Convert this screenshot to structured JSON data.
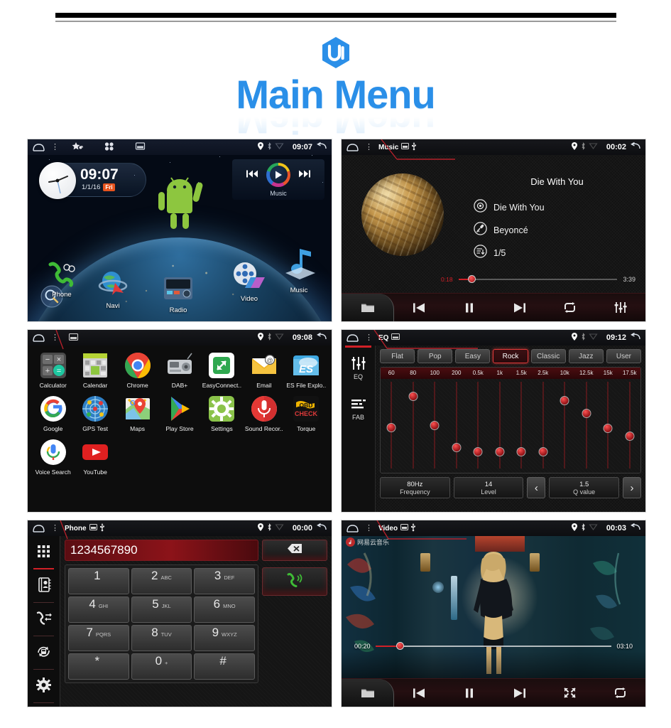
{
  "header": {
    "logo_name": "ui-hexagon-logo",
    "logo_text": "UI",
    "title": "Main Menu",
    "accent_color": "#2a8fe8"
  },
  "screens": {
    "home": {
      "name": "home-screen",
      "statusbar": {
        "home_icon": "home-icon",
        "menu_icon": "overflow-menu-icon",
        "shortcuts": [
          "favorites-star-icon",
          "apps-grid-icon",
          "screenshot-icon"
        ],
        "gps_icon": "location-pin-icon",
        "bluetooth_icon": "bluetooth-icon",
        "wifi_icon": "wifi-icon",
        "time": "09:07",
        "back_icon": "back-arrow-icon"
      },
      "clock": {
        "time": "09:07",
        "date": "1/1/16",
        "weekday": "Fri"
      },
      "music_widget": {
        "label": "Music",
        "prev_icon": "previous-track-icon",
        "play_icon": "play-icon",
        "next_icon": "next-track-icon"
      },
      "apps": [
        {
          "label": "Phone",
          "icon": "phone-handset-icon"
        },
        {
          "label": "Navi",
          "icon": "globe-navigation-icon"
        },
        {
          "label": "Radio",
          "icon": "radio-icon"
        },
        {
          "label": "Video",
          "icon": "film-reel-icon"
        },
        {
          "label": "Music",
          "icon": "music-note-icon"
        }
      ],
      "search_icon": "magnifier-icon",
      "mascot_icon": "android-robot-icon"
    },
    "music": {
      "name": "music-player-screen",
      "statusbar": {
        "title": "Music",
        "sd_icon": "sd-card-icon",
        "usb_icon": "usb-icon",
        "time": "00:02"
      },
      "song_title": "Die With You",
      "meta": [
        {
          "icon": "disc-icon",
          "value": "Die With You"
        },
        {
          "icon": "artist-mic-icon",
          "value": "Beyoncé"
        },
        {
          "icon": "playlist-icon",
          "value": "1/5"
        }
      ],
      "progress": {
        "current": "0:18",
        "total": "3:39",
        "percent": 8
      },
      "controls": [
        {
          "icon": "folder-icon",
          "name": "file-browser-button"
        },
        {
          "icon": "previous-track-icon",
          "name": "previous-button"
        },
        {
          "icon": "pause-icon",
          "name": "pause-button"
        },
        {
          "icon": "next-track-icon",
          "name": "next-button"
        },
        {
          "icon": "repeat-icon",
          "name": "repeat-button"
        },
        {
          "icon": "equalizer-icon",
          "name": "equalizer-button"
        }
      ]
    },
    "apps": {
      "name": "app-drawer-screen",
      "statusbar": {
        "time": "09:08",
        "screenshot_icon": "screenshot-icon"
      },
      "items": [
        {
          "label": "Calculator",
          "icon": "calculator-icon"
        },
        {
          "label": "Calendar",
          "icon": "calendar-icon"
        },
        {
          "label": "Chrome",
          "icon": "chrome-icon"
        },
        {
          "label": "DAB+",
          "icon": "dab-radio-icon"
        },
        {
          "label": "EasyConnect..",
          "icon": "easyconnect-icon"
        },
        {
          "label": "Email",
          "icon": "email-icon"
        },
        {
          "label": "ES File Explo..",
          "icon": "es-file-explorer-icon"
        },
        {
          "label": "Google",
          "icon": "google-icon"
        },
        {
          "label": "GPS Test",
          "icon": "gps-test-icon"
        },
        {
          "label": "Maps",
          "icon": "maps-icon"
        },
        {
          "label": "Play Store",
          "icon": "play-store-icon"
        },
        {
          "label": "Settings",
          "icon": "settings-gear-icon"
        },
        {
          "label": "Sound Recor..",
          "icon": "sound-recorder-icon"
        },
        {
          "label": "Torque",
          "icon": "torque-obd-icon"
        },
        {
          "label": "Voice Search",
          "icon": "voice-search-icon"
        },
        {
          "label": "YouTube",
          "icon": "youtube-icon"
        }
      ]
    },
    "eq": {
      "name": "equalizer-screen",
      "statusbar": {
        "title": "EQ",
        "screenshot_icon": "screenshot-icon",
        "time": "09:12"
      },
      "sidebar": [
        {
          "label": "EQ",
          "icon": "equalizer-sliders-icon",
          "active": true
        },
        {
          "label": "FAB",
          "icon": "fab-bars-icon",
          "active": false
        }
      ],
      "presets": [
        {
          "label": "Flat",
          "active": false
        },
        {
          "label": "Pop",
          "active": false
        },
        {
          "label": "Easy",
          "active": false
        },
        {
          "label": "Rock",
          "active": true
        },
        {
          "label": "Classic",
          "active": false
        },
        {
          "label": "Jazz",
          "active": false
        },
        {
          "label": "User",
          "active": false
        }
      ],
      "bands": [
        "60",
        "80",
        "100",
        "200",
        "0.5k",
        "1k",
        "1.5k",
        "2.5k",
        "10k",
        "12.5k",
        "15k",
        "17.5k"
      ],
      "band_positions": [
        47,
        14,
        45,
        68,
        73,
        73,
        73,
        73,
        18,
        32,
        48,
        56
      ],
      "fields": [
        {
          "value": "80Hz",
          "key": "Frequency"
        },
        {
          "value": "14",
          "key": "Level"
        },
        {
          "value": "1.5",
          "key": "Q value"
        }
      ],
      "prev_icon": "chevron-left-icon",
      "next_icon": "chevron-right-icon"
    },
    "phone": {
      "name": "phone-dialer-screen",
      "statusbar": {
        "title": "Phone",
        "sd_icon": "sd-card-icon",
        "usb_icon": "usb-icon",
        "time": "00:00"
      },
      "sidebar": [
        {
          "icon": "dialpad-icon",
          "active": true
        },
        {
          "icon": "contacts-book-icon",
          "active": false
        },
        {
          "icon": "call-log-icon",
          "active": false
        },
        {
          "icon": "sync-contacts-icon",
          "active": false
        },
        {
          "icon": "settings-gear-icon",
          "active": false
        }
      ],
      "number": "1234567890",
      "delete_icon": "backspace-icon",
      "call_icon": "call-handset-icon",
      "keys": [
        {
          "num": "1",
          "sub": ""
        },
        {
          "num": "2",
          "sub": "ABC"
        },
        {
          "num": "3",
          "sub": "DEF"
        },
        {
          "num": "4",
          "sub": "GHI"
        },
        {
          "num": "5",
          "sub": "JKL"
        },
        {
          "num": "6",
          "sub": "MNO"
        },
        {
          "num": "7",
          "sub": "PQRS"
        },
        {
          "num": "8",
          "sub": "TUV"
        },
        {
          "num": "9",
          "sub": "WXYZ"
        },
        {
          "num": "*",
          "sub": ""
        },
        {
          "num": "0",
          "sub": "+"
        },
        {
          "num": "#",
          "sub": ""
        }
      ]
    },
    "video": {
      "name": "video-player-screen",
      "statusbar": {
        "title": "Video",
        "sd_icon": "sd-card-icon",
        "usb_icon": "usb-icon",
        "time": "00:03"
      },
      "watermark": "网易云音乐",
      "progress": {
        "current": "00:20",
        "total": "03:10",
        "percent": 11
      },
      "controls": [
        {
          "icon": "folder-icon",
          "name": "file-browser-button"
        },
        {
          "icon": "previous-track-icon",
          "name": "previous-button"
        },
        {
          "icon": "pause-icon",
          "name": "pause-button"
        },
        {
          "icon": "next-track-icon",
          "name": "next-button"
        },
        {
          "icon": "fullscreen-icon",
          "name": "fullscreen-button"
        },
        {
          "icon": "repeat-icon",
          "name": "repeat-button"
        }
      ]
    }
  }
}
